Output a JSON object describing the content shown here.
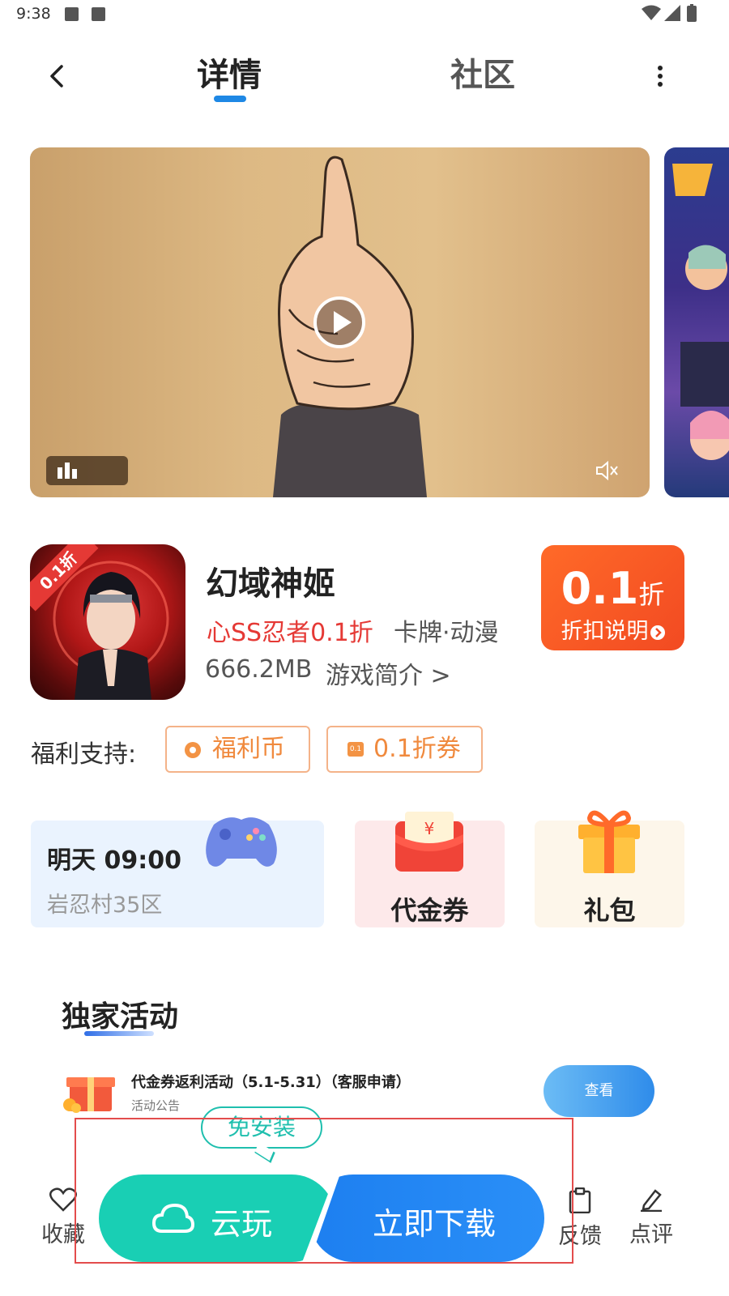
{
  "status_bar": {
    "time": "9:38"
  },
  "header": {
    "tabs": [
      {
        "label": "详情"
      },
      {
        "label": "社区"
      }
    ]
  },
  "game": {
    "name": "幻域神姬",
    "icon_badge": "0.1折",
    "tag_highlight": "心SS忍者0.1折",
    "genre": "卡牌·动漫",
    "size": "666.2MB",
    "intro_link": "游戏简介 >"
  },
  "discount": {
    "value": "0.1",
    "unit": "折",
    "explain": "折扣说明"
  },
  "welfare": {
    "label": "福利支持:",
    "chips": [
      {
        "label": "福利币"
      },
      {
        "label": "0.1折券"
      }
    ],
    "ticket_text": "0.1"
  },
  "server_card": {
    "time": "明天 09:00",
    "server": "岩忍村35区"
  },
  "cards": [
    {
      "label": "代金券"
    },
    {
      "label": "礼包"
    }
  ],
  "exclusive": {
    "title": "独家活动",
    "items": [
      {
        "title": "代金券返利活动（5.1-5.31）（客服申请）",
        "subtitle": "活动公告",
        "button": "查看"
      }
    ]
  },
  "bottom_bar": {
    "favorite": "收藏",
    "bubble": "免安装",
    "cloud_play": "云玩",
    "download": "立即下载",
    "feedback": "反馈",
    "review": "点评"
  },
  "colors": {
    "accent_blue": "#1e88e5",
    "discount_orange": "#ff5a24",
    "teal": "#19cfb4",
    "red_text": "#e53935"
  }
}
